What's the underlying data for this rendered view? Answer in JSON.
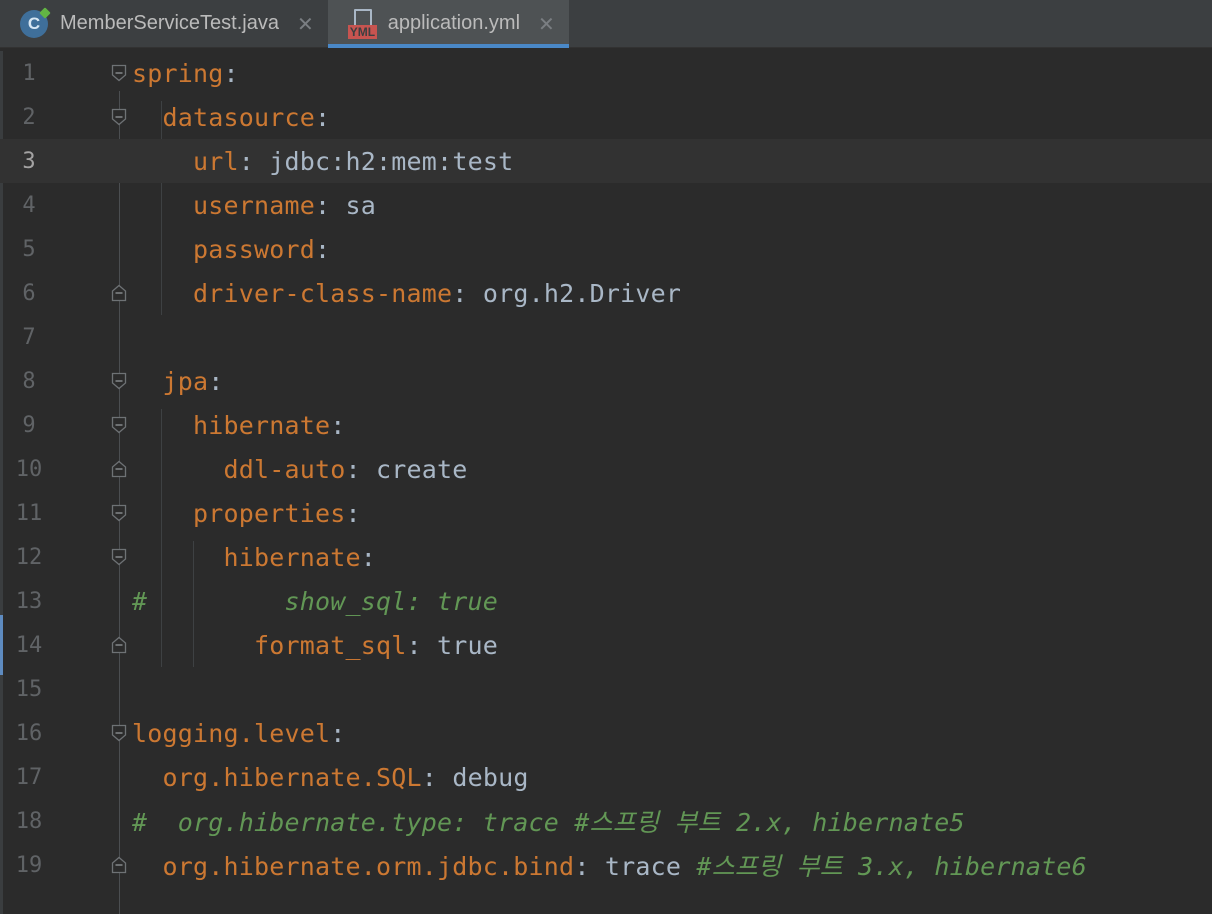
{
  "tabs": [
    {
      "label": "MemberServiceTest.java",
      "icon": "java-class-icon",
      "active": false
    },
    {
      "label": "application.yml",
      "icon": "yaml-file-icon",
      "active": true
    }
  ],
  "editor": {
    "current_line": 3,
    "lines": [
      {
        "n": "1",
        "indent": "",
        "key": "spring",
        "sep": ":",
        "value": "",
        "comment": ""
      },
      {
        "n": "2",
        "indent": "  ",
        "key": "datasource",
        "sep": ":",
        "value": "",
        "comment": ""
      },
      {
        "n": "3",
        "indent": "    ",
        "key": "url",
        "sep": ":",
        "value": " jdbc:h2:mem:test",
        "comment": ""
      },
      {
        "n": "4",
        "indent": "    ",
        "key": "username",
        "sep": ":",
        "value": " sa",
        "comment": ""
      },
      {
        "n": "5",
        "indent": "    ",
        "key": "password",
        "sep": ":",
        "value": "",
        "comment": ""
      },
      {
        "n": "6",
        "indent": "    ",
        "key": "driver-class-name",
        "sep": ":",
        "value": " org.h2.Driver",
        "comment": ""
      },
      {
        "n": "7",
        "indent": "",
        "key": "",
        "sep": "",
        "value": "",
        "comment": ""
      },
      {
        "n": "8",
        "indent": "  ",
        "key": "jpa",
        "sep": ":",
        "value": "",
        "comment": ""
      },
      {
        "n": "9",
        "indent": "    ",
        "key": "hibernate",
        "sep": ":",
        "value": "",
        "comment": ""
      },
      {
        "n": "10",
        "indent": "      ",
        "key": "ddl-auto",
        "sep": ":",
        "value": " create",
        "comment": ""
      },
      {
        "n": "11",
        "indent": "    ",
        "key": "properties",
        "sep": ":",
        "value": "",
        "comment": ""
      },
      {
        "n": "12",
        "indent": "      ",
        "key": "hibernate",
        "sep": ":",
        "value": "",
        "comment": ""
      },
      {
        "n": "13",
        "indent": "",
        "key": "",
        "sep": "",
        "value": "",
        "comment": "#         show_sql: true"
      },
      {
        "n": "14",
        "indent": "        ",
        "key": "format_sql",
        "sep": ":",
        "value": " true",
        "comment": ""
      },
      {
        "n": "15",
        "indent": "",
        "key": "",
        "sep": "",
        "value": "",
        "comment": ""
      },
      {
        "n": "16",
        "indent": "",
        "key": "logging.level",
        "sep": ":",
        "value": "",
        "comment": ""
      },
      {
        "n": "17",
        "indent": "  ",
        "key": "org.hibernate.SQL",
        "sep": ":",
        "value": " debug",
        "comment": ""
      },
      {
        "n": "18",
        "indent": "",
        "key": "",
        "sep": "",
        "value": "",
        "comment": "#  org.hibernate.type: trace #스프링 부트 2.x, hibernate5"
      },
      {
        "n": "19",
        "indent": "  ",
        "key": "org.hibernate.orm.jdbc.bind",
        "sep": ":",
        "value": " trace ",
        "comment": "#스프링 부트 3.x, hibernate6"
      }
    ]
  }
}
